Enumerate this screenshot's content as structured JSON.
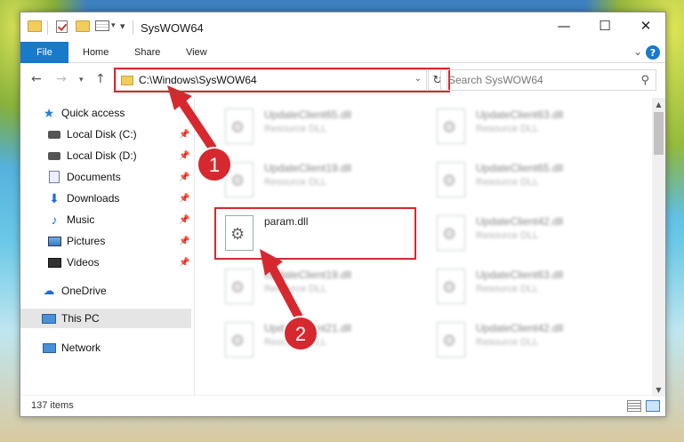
{
  "window": {
    "title": "SysWOW64",
    "minimize": "—",
    "maximize": "☐",
    "close": "✕"
  },
  "ribbon": {
    "tabs": [
      "File",
      "Home",
      "Share",
      "View"
    ]
  },
  "address": {
    "path": "C:\\Windows\\SysWOW64",
    "search_placeholder": "Search SysWOW64"
  },
  "nav": {
    "items": [
      {
        "label": "Quick access",
        "icon": "star-icon"
      },
      {
        "label": "Local Disk (C:)",
        "icon": "drive-icon",
        "pinned": true
      },
      {
        "label": "Local Disk (D:)",
        "icon": "drive-icon",
        "pinned": true
      },
      {
        "label": "Documents",
        "icon": "documents-icon",
        "pinned": true
      },
      {
        "label": "Downloads",
        "icon": "download-icon",
        "pinned": true
      },
      {
        "label": "Music",
        "icon": "music-icon",
        "pinned": true
      },
      {
        "label": "Pictures",
        "icon": "pictures-icon",
        "pinned": true
      },
      {
        "label": "Videos",
        "icon": "videos-icon",
        "pinned": true
      },
      {
        "label": "OneDrive",
        "icon": "onedrive-icon"
      },
      {
        "label": "This PC",
        "icon": "computer-icon",
        "selected": true
      },
      {
        "label": "Network",
        "icon": "network-icon"
      }
    ]
  },
  "files": [
    {
      "name": "UpdateClient65.dll",
      "type": "Resource DLL"
    },
    {
      "name": "UpdateClient63.dll",
      "type": "Resource DLL"
    },
    {
      "name": "UpdateClient19.dll",
      "type": "Resource DLL"
    },
    {
      "name": "UpdateClient65.dll",
      "type": "Resource DLL"
    },
    {
      "name": "param.dll",
      "type": ""
    },
    {
      "name": "UpdateClient42.dll",
      "type": "Resource DLL"
    },
    {
      "name": "UpdateClient19.dll",
      "type": "Resource DLL"
    },
    {
      "name": "UpdateClient63.dll",
      "type": "Resource DLL"
    },
    {
      "name": "UpdateClient21.dll",
      "type": "Resource DLL"
    },
    {
      "name": "UpdateClient42.dll",
      "type": "Resource DLL"
    }
  ],
  "status": {
    "item_count": "137 items"
  },
  "annotations": {
    "step1": "1",
    "step2": "2",
    "color": "#d6292f"
  }
}
